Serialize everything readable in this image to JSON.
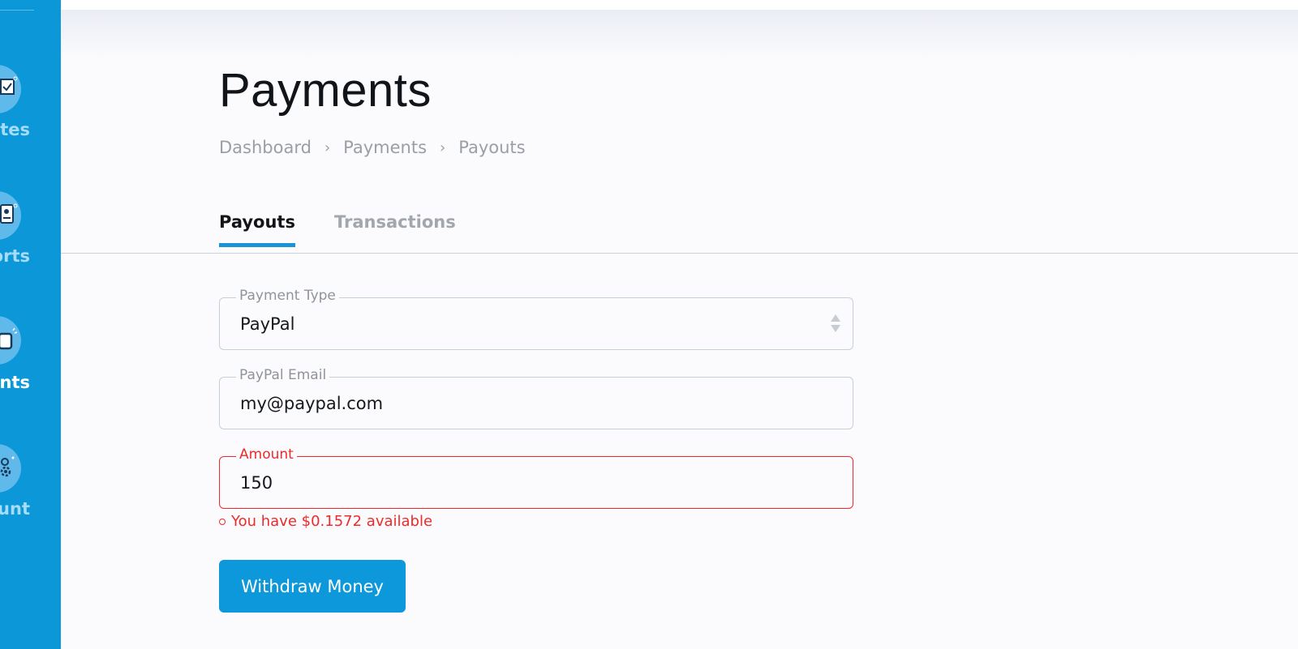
{
  "sidebar": {
    "items": [
      {
        "label": "Sites",
        "visible_label": "ites",
        "icon": "browser-window-icon",
        "active": false
      },
      {
        "label": "Reports",
        "visible_label": "orts",
        "icon": "report-document-icon",
        "active": false
      },
      {
        "label": "Payments",
        "visible_label": "ents",
        "icon": "wallet-icon",
        "active": true
      },
      {
        "label": "Account",
        "visible_label": "unt",
        "icon": "user-gear-icon",
        "active": false
      }
    ]
  },
  "page": {
    "title": "Payments"
  },
  "breadcrumb": {
    "items": [
      "Dashboard",
      "Payments",
      "Payouts"
    ],
    "separator": "›"
  },
  "tabs": [
    {
      "label": "Payouts",
      "active": true
    },
    {
      "label": "Transactions",
      "active": false
    }
  ],
  "form": {
    "payment_type": {
      "label": "Payment Type",
      "value": "PayPal"
    },
    "paypal_email": {
      "label": "PayPal Email",
      "value": "my@paypal.com"
    },
    "amount": {
      "label": "Amount",
      "value": "150"
    },
    "error": "You have $0.1572 available",
    "submit_label": "Withdraw Money"
  },
  "colors": {
    "sidebar": "#0b97d8",
    "accent": "#1a93d6",
    "error": "#ee2a2a",
    "background": "#fbfbfd"
  }
}
